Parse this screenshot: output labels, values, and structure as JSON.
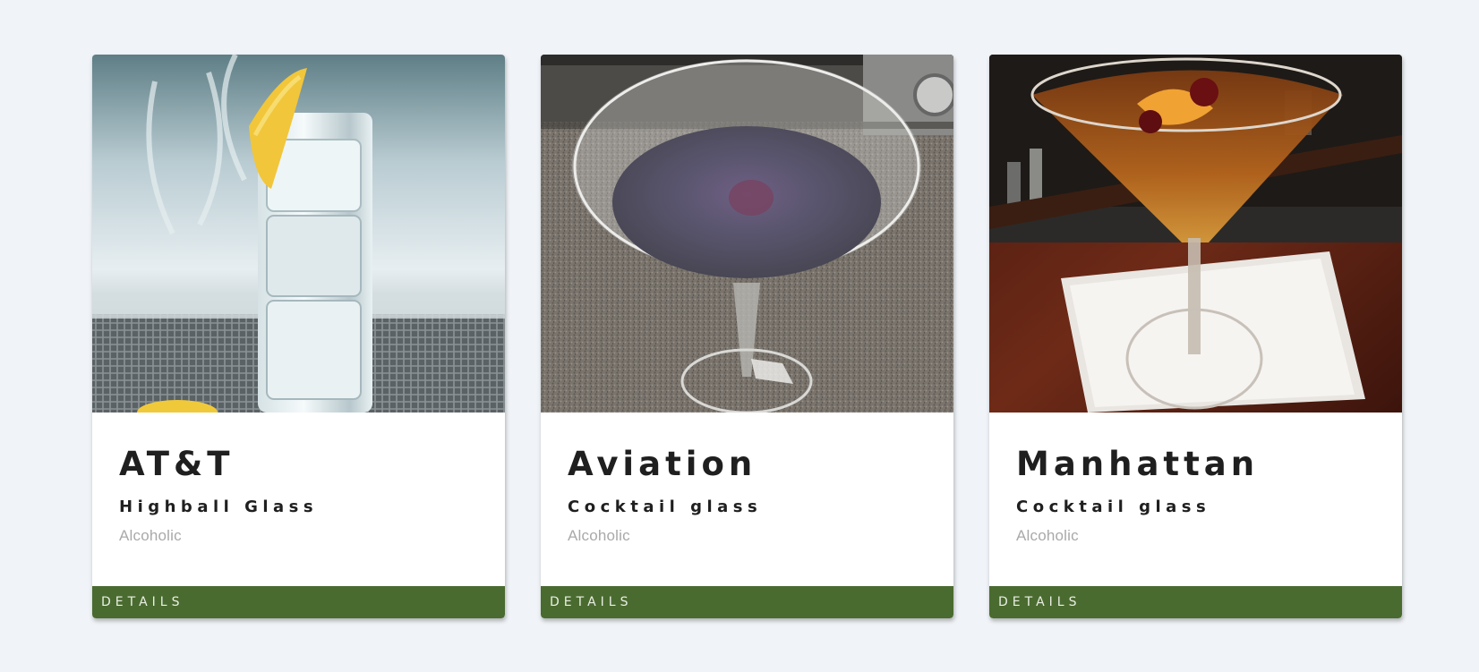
{
  "cards": [
    {
      "name": "AT&T",
      "glass": "Highball Glass",
      "category": "Alcoholic",
      "button": "DETAILS"
    },
    {
      "name": "Aviation",
      "glass": "Cocktail glass",
      "category": "Alcoholic",
      "button": "DETAILS"
    },
    {
      "name": "Manhattan",
      "glass": "Cocktail glass",
      "category": "Alcoholic",
      "button": "DETAILS"
    }
  ],
  "colors": {
    "page_background": "#f0f3f7",
    "button_background": "#4a6b30",
    "title_text": "#1f1f1f",
    "category_text": "#a9a9a9"
  }
}
